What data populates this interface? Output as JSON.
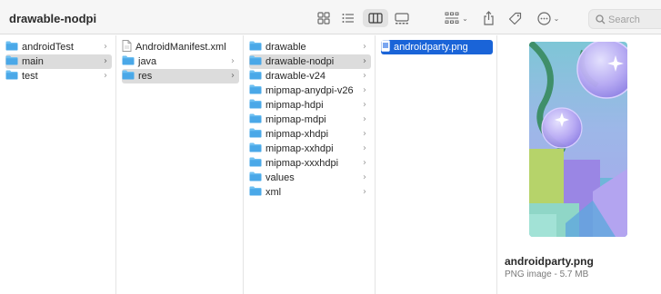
{
  "window": {
    "title": "drawable-nodpi"
  },
  "toolbar": {
    "buttons": [
      {
        "name": "icon-view-button",
        "icon": "grid-icon"
      },
      {
        "name": "list-view-button",
        "icon": "list-icon"
      },
      {
        "name": "column-view-button",
        "icon": "columns-icon",
        "active": true
      },
      {
        "name": "gallery-view-button",
        "icon": "gallery-icon"
      },
      {
        "name": "group-button",
        "icon": "group-grid-icon"
      },
      {
        "name": "share-button",
        "icon": "share-icon"
      },
      {
        "name": "tags-button",
        "icon": "tag-icon"
      },
      {
        "name": "more-actions-button",
        "icon": "ellipsis-circle-icon"
      }
    ],
    "search": {
      "placeholder": "Search"
    }
  },
  "columns": [
    {
      "items": [
        {
          "label": "androidTest",
          "type": "folder",
          "has_children": true
        },
        {
          "label": "main",
          "type": "folder",
          "has_children": true,
          "selected": "gray"
        },
        {
          "label": "test",
          "type": "folder",
          "has_children": true
        }
      ]
    },
    {
      "items": [
        {
          "label": "AndroidManifest.xml",
          "type": "file",
          "has_children": false
        },
        {
          "label": "java",
          "type": "folder",
          "has_children": true
        },
        {
          "label": "res",
          "type": "folder",
          "has_children": true,
          "selected": "gray"
        }
      ]
    },
    {
      "items": [
        {
          "label": "drawable",
          "type": "folder",
          "has_children": true
        },
        {
          "label": "drawable-nodpi",
          "type": "folder",
          "has_children": true,
          "selected": "gray"
        },
        {
          "label": "drawable-v24",
          "type": "folder",
          "has_children": true
        },
        {
          "label": "mipmap-anydpi-v26",
          "type": "folder",
          "has_children": true
        },
        {
          "label": "mipmap-hdpi",
          "type": "folder",
          "has_children": true
        },
        {
          "label": "mipmap-mdpi",
          "type": "folder",
          "has_children": true
        },
        {
          "label": "mipmap-xhdpi",
          "type": "folder",
          "has_children": true
        },
        {
          "label": "mipmap-xxhdpi",
          "type": "folder",
          "has_children": true
        },
        {
          "label": "mipmap-xxxhdpi",
          "type": "folder",
          "has_children": true
        },
        {
          "label": "values",
          "type": "folder",
          "has_children": true
        },
        {
          "label": "xml",
          "type": "folder",
          "has_children": true
        }
      ]
    },
    {
      "items": [
        {
          "label": "androidparty.png",
          "type": "image",
          "has_children": false,
          "selected": "blue"
        }
      ]
    }
  ],
  "preview": {
    "file_name": "androidparty.png",
    "file_info": "PNG image - 5.7 MB"
  },
  "colors": {
    "selection_blue": "#1a64d8",
    "selection_gray": "#dcdcdc",
    "folder_blue": "#4aa8e8"
  }
}
